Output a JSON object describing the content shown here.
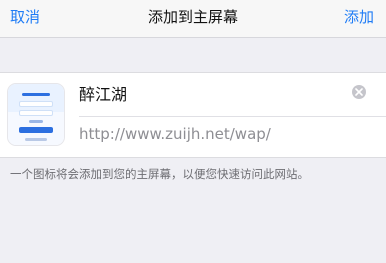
{
  "nav": {
    "cancel_label": "取消",
    "title": "添加到主屏幕",
    "add_label": "添加"
  },
  "form": {
    "app_name": "醉江湖",
    "url": "http://www.zuijh.net/wap/",
    "clear_icon": "clear-circle-icon",
    "app_icon": "app-thumbnail-icon"
  },
  "hint": "一个图标将会添加到您的主屏幕，以便您快速访问此网站。",
  "colors": {
    "accent": "#1f7cf6",
    "background": "#efeff4",
    "card": "#ffffff",
    "secondary_text": "#8e8e93"
  }
}
